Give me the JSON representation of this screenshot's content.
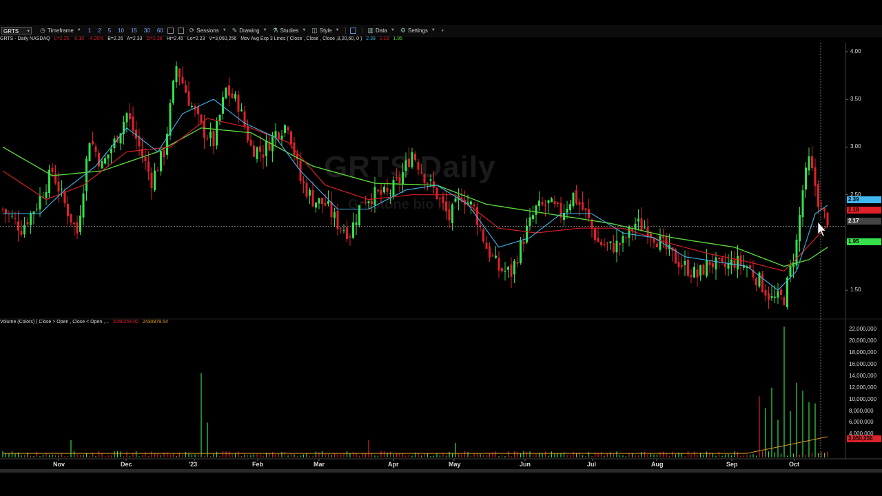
{
  "toolbar": {
    "symbol": "GRTS",
    "timeframe_label": "Timeframe",
    "intervals": [
      "1",
      "2",
      "5",
      "10",
      "15",
      "30",
      "60"
    ],
    "sessions_label": "Sessions",
    "drawing_label": "Drawing",
    "studies_label": "Studies",
    "style_label": "Style",
    "data_label": "Data",
    "settings_label": "Settings"
  },
  "info": {
    "symbol_line": "GRTS - Daily  NASDAQ",
    "last": "L=2.25",
    "change": "-0.10",
    "change_pct": "-4.26%",
    "bid": "B=2.26",
    "ask": "A=2.33",
    "open": "O=2.38",
    "high": "Hi=2.45",
    "low": "Lo=2.23",
    "volume": "V=3,050,256",
    "ma_label": "Mov Avg Exp 3 Lines ( Close , Close , Close ,8,20,60, 0 )",
    "ma1": "2.39",
    "ma2": "2.18",
    "ma3": "1.95"
  },
  "volume_info": {
    "label": "Volume (Colors) ( Close > Open , Close < Open ,...",
    "v1": "3050256.00",
    "v2": "2430879.54"
  },
  "watermark": {
    "line1": "GRTS Daily",
    "line2": "Gritstone bio Inc"
  },
  "badges": {
    "ma8": "2.39",
    "ma20": "2.18",
    "cursor": "2.17",
    "ma60": "1.95",
    "vol": "3,050,256"
  },
  "colors": {
    "up": "#35e04a",
    "down": "#e0202a",
    "ma8": "#3fb7f0",
    "ma20": "#d81f25",
    "ma60": "#5ad43a",
    "volavg": "#e09a2a"
  },
  "chart_data": {
    "type": "candlestick",
    "price_axis": {
      "ticks": [
        "4.00",
        "3.50",
        "3.00",
        "2.50",
        "2.00",
        "1.50"
      ],
      "ylim": [
        1.22,
        4.05
      ]
    },
    "volume_axis": {
      "ticks": [
        "22,000,000",
        "20,000,000",
        "18,000,000",
        "16,000,000",
        "14,000,000",
        "12,000,000",
        "10,000,000",
        "8,000,000",
        "6,000,000",
        "4,000,000"
      ],
      "ylim": [
        0,
        23000000
      ]
    },
    "x_labels": [
      "Nov",
      "Dec",
      "'23",
      "Feb",
      "Mar",
      "Apr",
      "May",
      "Jun",
      "Jul",
      "Aug",
      "Sep",
      "Oct"
    ],
    "close_path": [
      [
        0,
        2.35
      ],
      [
        6,
        2.15
      ],
      [
        11,
        2.4
      ],
      [
        16,
        2.75
      ],
      [
        20,
        2.4
      ],
      [
        24,
        2.1
      ],
      [
        28,
        3.1
      ],
      [
        32,
        2.8
      ],
      [
        36,
        3.05
      ],
      [
        40,
        3.35
      ],
      [
        44,
        3.0
      ],
      [
        48,
        2.65
      ],
      [
        52,
        2.95
      ],
      [
        56,
        3.85
      ],
      [
        60,
        3.5
      ],
      [
        64,
        3.2
      ],
      [
        68,
        3.05
      ],
      [
        72,
        3.6
      ],
      [
        76,
        3.45
      ],
      [
        80,
        3.0
      ],
      [
        84,
        2.95
      ],
      [
        88,
        3.15
      ],
      [
        92,
        3.25
      ],
      [
        96,
        2.65
      ],
      [
        100,
        2.45
      ],
      [
        104,
        2.4
      ],
      [
        108,
        2.2
      ],
      [
        112,
        2.1
      ],
      [
        116,
        2.45
      ],
      [
        120,
        2.5
      ],
      [
        124,
        2.5
      ],
      [
        128,
        2.65
      ],
      [
        132,
        2.95
      ],
      [
        136,
        2.7
      ],
      [
        140,
        2.5
      ],
      [
        144,
        2.25
      ],
      [
        148,
        2.5
      ],
      [
        152,
        2.35
      ],
      [
        156,
        1.95
      ],
      [
        160,
        1.72
      ],
      [
        164,
        1.68
      ],
      [
        168,
        2.05
      ],
      [
        172,
        2.35
      ],
      [
        176,
        2.4
      ],
      [
        180,
        2.3
      ],
      [
        184,
        2.5
      ],
      [
        188,
        2.3
      ],
      [
        192,
        2.0
      ],
      [
        196,
        1.95
      ],
      [
        200,
        2.0
      ],
      [
        204,
        2.2
      ],
      [
        208,
        2.15
      ],
      [
        212,
        2.0
      ],
      [
        216,
        1.85
      ],
      [
        220,
        1.75
      ],
      [
        224,
        1.65
      ],
      [
        228,
        1.8
      ],
      [
        232,
        1.72
      ],
      [
        236,
        1.8
      ],
      [
        240,
        1.75
      ],
      [
        244,
        1.6
      ],
      [
        248,
        1.4
      ],
      [
        252,
        1.42
      ],
      [
        256,
        2.0
      ],
      [
        258,
        2.55
      ],
      [
        260,
        2.85
      ],
      [
        262,
        2.6
      ],
      [
        264,
        2.3
      ],
      [
        266,
        2.25
      ]
    ],
    "ma8_path": [
      [
        0,
        2.3
      ],
      [
        12,
        2.3
      ],
      [
        20,
        2.55
      ],
      [
        30,
        2.8
      ],
      [
        40,
        3.2
      ],
      [
        50,
        2.95
      ],
      [
        58,
        3.35
      ],
      [
        68,
        3.5
      ],
      [
        78,
        3.25
      ],
      [
        88,
        3.1
      ],
      [
        96,
        2.75
      ],
      [
        108,
        2.35
      ],
      [
        118,
        2.35
      ],
      [
        130,
        2.55
      ],
      [
        140,
        2.6
      ],
      [
        150,
        2.4
      ],
      [
        160,
        1.95
      ],
      [
        170,
        2.05
      ],
      [
        180,
        2.3
      ],
      [
        190,
        2.3
      ],
      [
        200,
        2.1
      ],
      [
        210,
        2.05
      ],
      [
        220,
        1.85
      ],
      [
        230,
        1.8
      ],
      [
        240,
        1.75
      ],
      [
        250,
        1.5
      ],
      [
        256,
        1.7
      ],
      [
        262,
        2.3
      ],
      [
        266,
        2.39
      ]
    ],
    "ma20_path": [
      [
        0,
        2.75
      ],
      [
        14,
        2.45
      ],
      [
        26,
        2.6
      ],
      [
        40,
        2.95
      ],
      [
        54,
        3.0
      ],
      [
        66,
        3.3
      ],
      [
        80,
        3.2
      ],
      [
        92,
        3.05
      ],
      [
        104,
        2.6
      ],
      [
        118,
        2.45
      ],
      [
        132,
        2.5
      ],
      [
        146,
        2.5
      ],
      [
        160,
        2.15
      ],
      [
        172,
        2.1
      ],
      [
        186,
        2.15
      ],
      [
        200,
        2.15
      ],
      [
        214,
        2.0
      ],
      [
        228,
        1.88
      ],
      [
        240,
        1.8
      ],
      [
        252,
        1.7
      ],
      [
        258,
        1.9
      ],
      [
        266,
        2.18
      ]
    ],
    "ma60_path": [
      [
        0,
        3.0
      ],
      [
        16,
        2.7
      ],
      [
        32,
        2.75
      ],
      [
        50,
        2.95
      ],
      [
        64,
        3.2
      ],
      [
        80,
        3.15
      ],
      [
        100,
        2.8
      ],
      [
        120,
        2.62
      ],
      [
        140,
        2.6
      ],
      [
        156,
        2.4
      ],
      [
        176,
        2.3
      ],
      [
        196,
        2.2
      ],
      [
        216,
        2.05
      ],
      [
        236,
        1.95
      ],
      [
        252,
        1.75
      ],
      [
        260,
        1.82
      ],
      [
        266,
        1.95
      ]
    ],
    "volume_spikes": [
      {
        "bar": 22,
        "value": 3000000,
        "up": true
      },
      {
        "bar": 64,
        "value": 14500000,
        "up": true
      },
      {
        "bar": 66,
        "value": 6000000,
        "up": true
      },
      {
        "bar": 118,
        "value": 3000000,
        "up": false
      },
      {
        "bar": 146,
        "value": 2500000,
        "up": true
      },
      {
        "bar": 244,
        "value": 10500000,
        "up": false
      },
      {
        "bar": 246,
        "value": 8500000,
        "up": true
      },
      {
        "bar": 248,
        "value": 12000000,
        "up": true
      },
      {
        "bar": 250,
        "value": 6500000,
        "up": true
      },
      {
        "bar": 252,
        "value": 22500000,
        "up": true
      },
      {
        "bar": 254,
        "value": 8000000,
        "up": true
      },
      {
        "bar": 256,
        "value": 12800000,
        "up": true
      },
      {
        "bar": 258,
        "value": 11500000,
        "up": true
      },
      {
        "bar": 260,
        "value": 9500000,
        "up": true
      },
      {
        "bar": 262,
        "value": 9300000,
        "up": true
      }
    ],
    "cursor_price": 2.17
  }
}
